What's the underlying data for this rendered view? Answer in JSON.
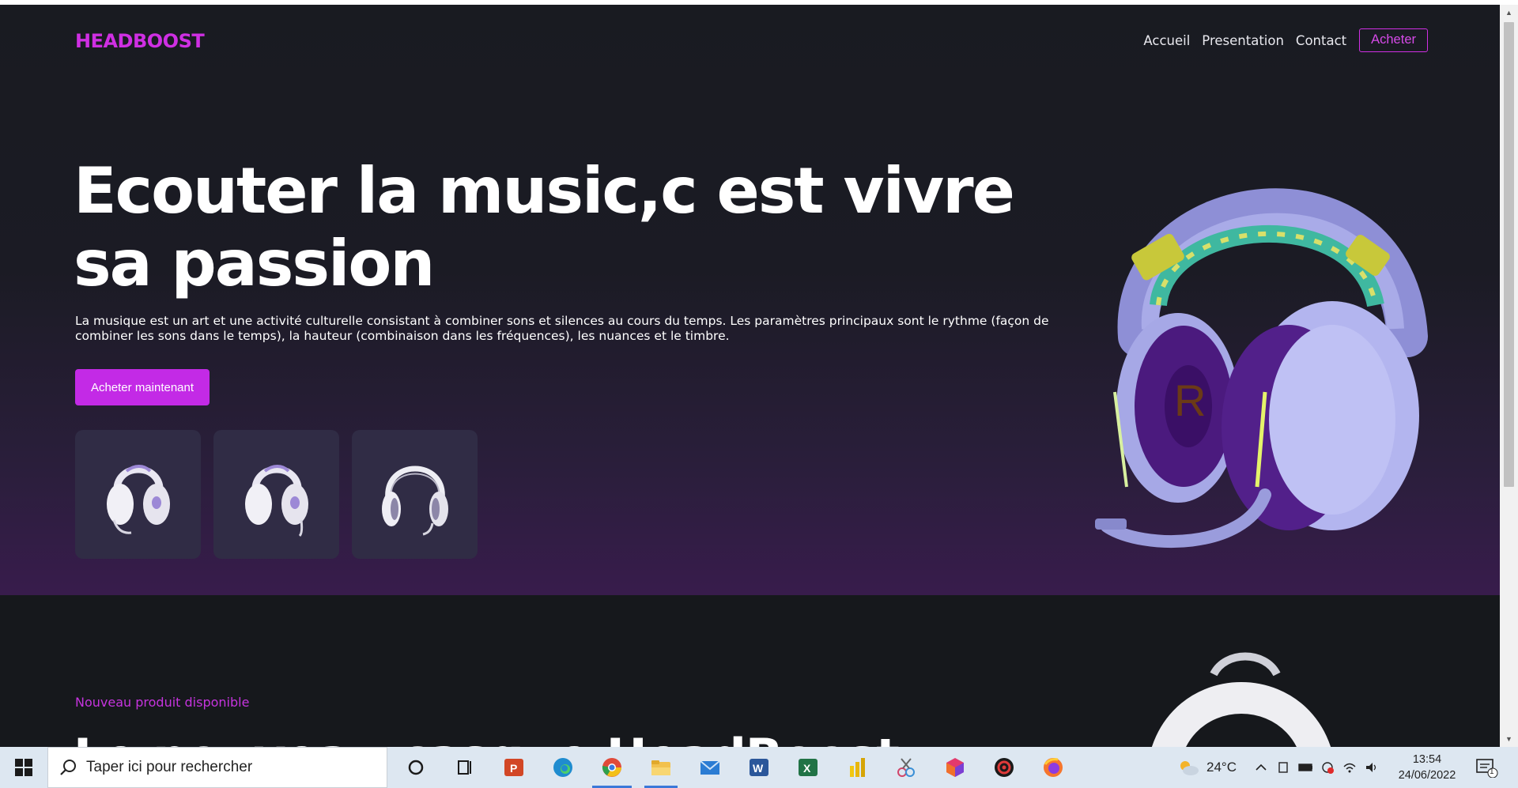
{
  "brand": "HEADBOOST",
  "nav": {
    "items": [
      {
        "label": "Accueil"
      },
      {
        "label": "Presentation"
      },
      {
        "label": "Contact"
      }
    ],
    "buy_label": "Acheter"
  },
  "hero": {
    "title": "Ecouter la music,c est vivre sa passion",
    "description": "La musique est un art et une activité culturelle consistant à combiner sons et silences au cours du temps. Les paramètres principaux sont le rythme (façon de combiner les sons dans le temps), la hauteur (combinaison dans les fréquences), les nuances et le timbre.",
    "cta_label": "Acheter maintenant",
    "thumbnails": [
      "headset-thumbnail",
      "headset-thumbnail",
      "headset-thumbnail"
    ]
  },
  "section2": {
    "kicker": "Nouveau produit disponible",
    "title": "Le nouveau casque HeadBoost"
  },
  "colors": {
    "accent": "#cf2fe3",
    "hero_gradient_end": "#381c4c",
    "background": "#16181c"
  },
  "taskbar": {
    "search_placeholder": "Taper ici pour rechercher",
    "apps": [
      "cortana-icon",
      "task-view-icon",
      "powerpoint-icon",
      "edge-icon",
      "chrome-icon",
      "file-explorer-icon",
      "mail-icon",
      "word-icon",
      "excel-icon",
      "power-bi-icon",
      "snipping-icon",
      "app-cube-icon",
      "settings-gear-app-icon",
      "firefox-icon"
    ],
    "weather": "24°C",
    "time": "13:54",
    "date": "24/06/2022",
    "notification_count": "1"
  }
}
